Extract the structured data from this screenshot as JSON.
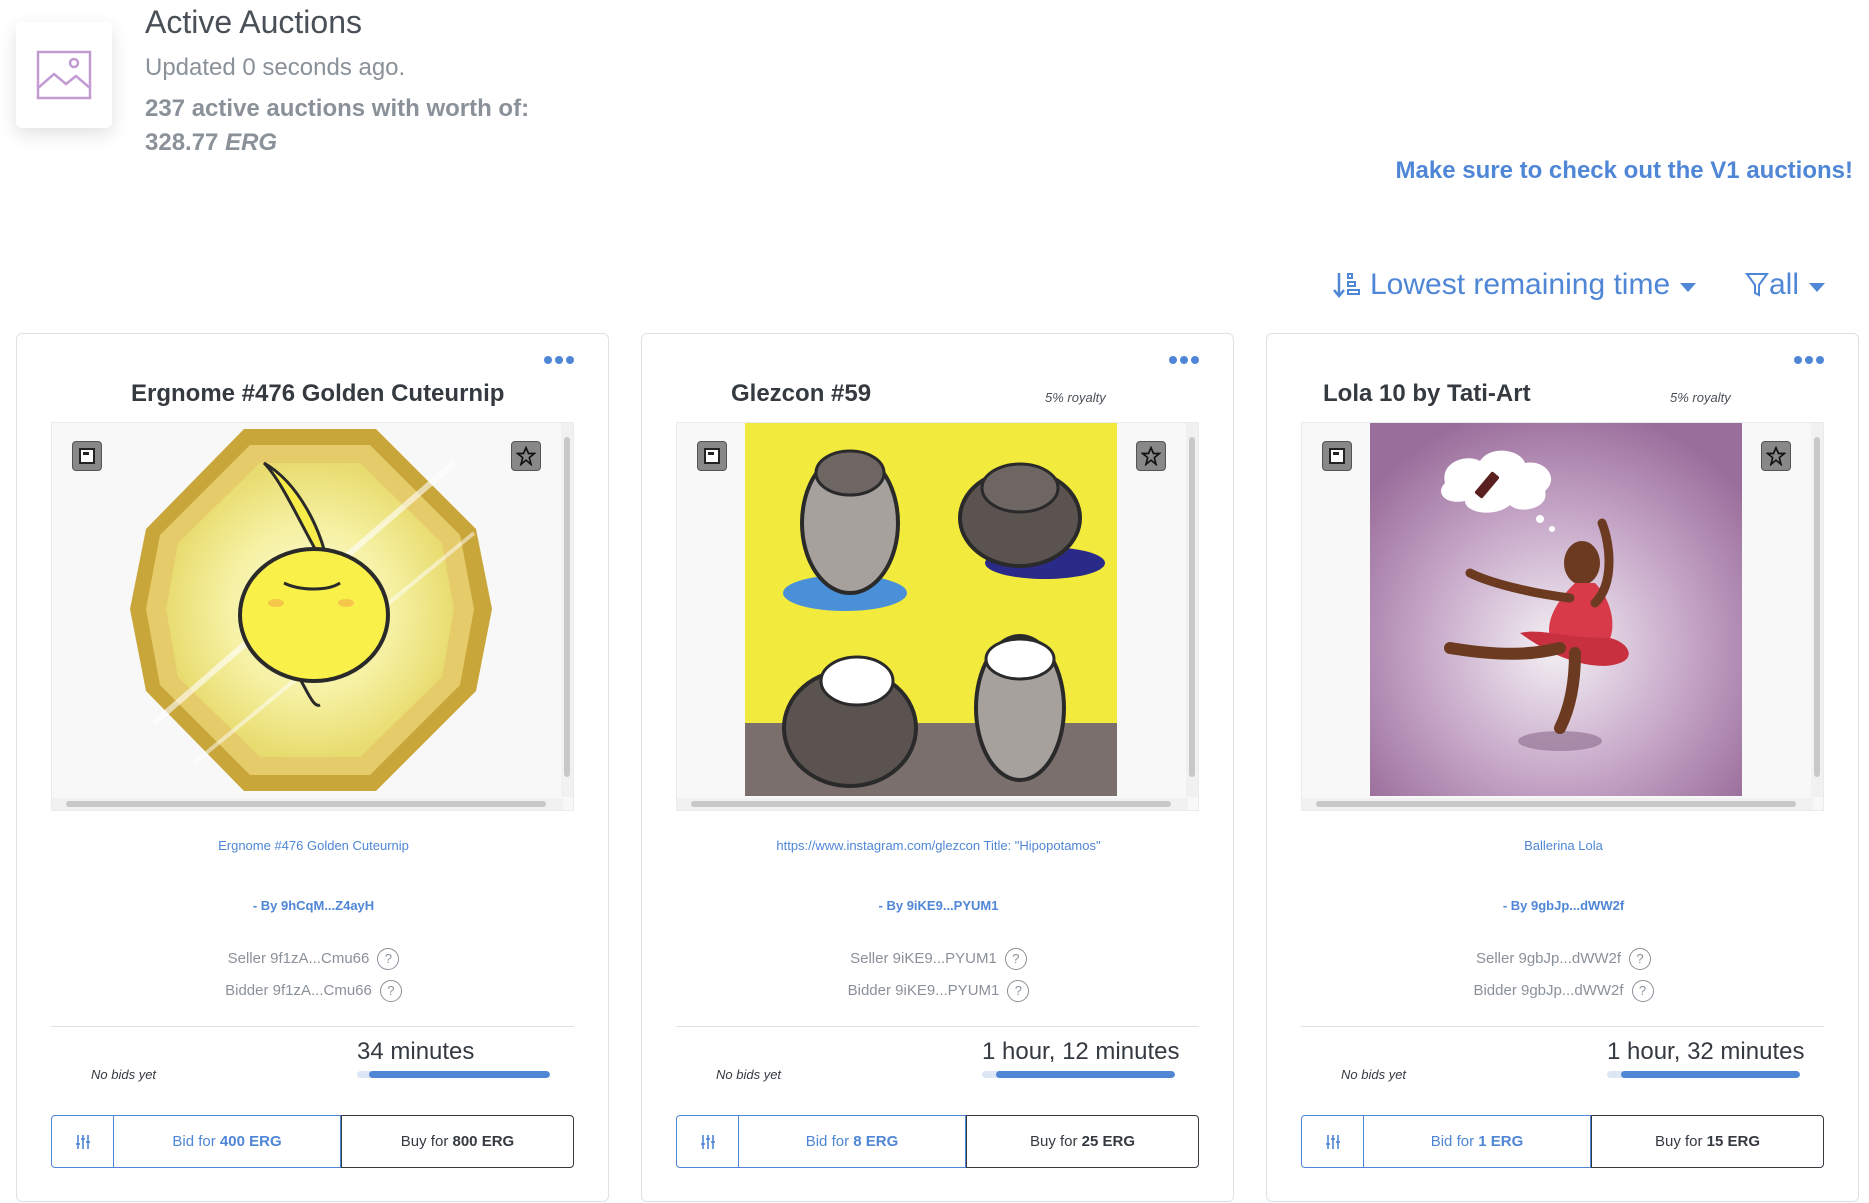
{
  "header": {
    "title": "Active Auctions",
    "updated": "Updated 0 seconds ago.",
    "summary_prefix": "237 active auctions with worth of:",
    "summary_amount": "328.77",
    "summary_unit": "ERG",
    "v1_link": "Make sure to check out the V1 auctions!"
  },
  "controls": {
    "sort_label": "Lowest remaining time",
    "filter_label": "all"
  },
  "cards": [
    {
      "title": "Ergnome #476 Golden Cuteurnip",
      "royalty": "",
      "description": "Ergnome #476 Golden Cuteurnip",
      "by": "- By 9hCqM...Z4ayH",
      "seller": "Seller 9f1zA...Cmu66",
      "bidder": "Bidder 9f1zA...Cmu66",
      "bids_status": "No bids yet",
      "remaining": "34 minutes",
      "remaining_fraction": 0.94,
      "bid_prefix": "Bid for",
      "bid_amount": "400 ERG",
      "buy_prefix": "Buy for",
      "buy_amount": "800 ERG",
      "q": "?"
    },
    {
      "title": "Glezcon #59",
      "royalty": "5% royalty",
      "description": "https://www.instagram.com/glezcon Title: \"Hipopotamos\"",
      "by": "- By 9iKE9...PYUM1",
      "seller": "Seller 9iKE9...PYUM1",
      "bidder": "Bidder 9iKE9...PYUM1",
      "bids_status": "No bids yet",
      "remaining": "1 hour, 12 minutes",
      "remaining_fraction": 0.93,
      "bid_prefix": "Bid for",
      "bid_amount": "8 ERG",
      "buy_prefix": "Buy for",
      "buy_amount": "25 ERG",
      "q": "?"
    },
    {
      "title": "Lola 10 by Tati-Art",
      "royalty": "5% royalty",
      "description": "Ballerina Lola",
      "by": "- By 9gbJp...dWW2f",
      "seller": "Seller 9gbJp...dWW2f",
      "bidder": "Bidder 9gbJp...dWW2f",
      "bids_status": "No bids yet",
      "remaining": "1 hour, 32 minutes",
      "remaining_fraction": 0.93,
      "bid_prefix": "Bid for",
      "bid_amount": "1 ERG",
      "buy_prefix": "Buy for",
      "buy_amount": "15 ERG",
      "q": "?"
    }
  ]
}
